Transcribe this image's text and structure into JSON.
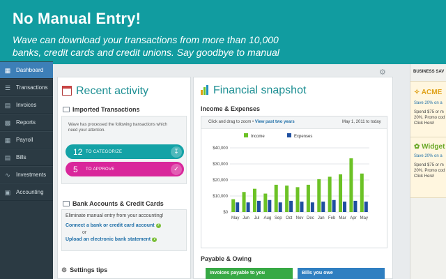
{
  "banner": {
    "title": "No Manual Entry!",
    "subtitle": "Wave can download your transactions from more than 10,000 banks, credit cards and credit unions. Say goodbye to manual entry!"
  },
  "sidebar": {
    "items": [
      {
        "label": "Dashboard",
        "icon": "dashboard-icon"
      },
      {
        "label": "Transactions",
        "icon": "transactions-icon"
      },
      {
        "label": "Invoices",
        "icon": "invoices-icon"
      },
      {
        "label": "Reports",
        "icon": "reports-icon"
      },
      {
        "label": "Payroll",
        "icon": "payroll-icon"
      },
      {
        "label": "Bills",
        "icon": "bills-icon"
      },
      {
        "label": "Investments",
        "icon": "investments-icon"
      },
      {
        "label": "Accounting",
        "icon": "accounting-icon"
      }
    ]
  },
  "recent": {
    "title": "Recent activity",
    "imported_head": "Imported Transactions",
    "imported_desc": "Wave has processed the following transactions which need your attention.",
    "categorize": {
      "count": "12",
      "label": "TO CATEGORIZE",
      "color": "#14a2a6"
    },
    "approve": {
      "count": "5",
      "label": "TO APPROVE",
      "color": "#d9279b"
    },
    "bank_head": "Bank Accounts & Credit Cards",
    "bank_desc": "Eliminate manual entry from your accounting!",
    "link_connect": "Connect a bank or credit card account",
    "or": "or",
    "link_upload": "Upload an electronic bank statement",
    "settings_head": "Settings tips"
  },
  "snapshot": {
    "title": "Financial snapshot",
    "income_head": "Income & Expenses",
    "zoom_hint": "Click and drag to zoom •",
    "view_link": "View past two years",
    "date_range": "May 1, 2011 to today",
    "payable_head": "Payable & Owing",
    "tab_invoices": "Invoices payable to you",
    "tab_bills": "Bills you owe"
  },
  "chart_data": {
    "type": "bar",
    "categories": [
      "May",
      "Jun",
      "Jul",
      "Aug",
      "Sep",
      "Oct",
      "Nov",
      "Dec",
      "Jan",
      "Feb",
      "Mar",
      "Apr",
      "May"
    ],
    "series": [
      {
        "name": "Income",
        "values": [
          8000,
          12500,
          14500,
          11500,
          17000,
          16500,
          15500,
          17000,
          20500,
          22000,
          23500,
          33500,
          24000
        ],
        "color": "#6cc226"
      },
      {
        "name": "Expenses",
        "values": [
          6000,
          6000,
          7000,
          7500,
          6000,
          7000,
          6500,
          6000,
          6500,
          7500,
          6500,
          7000,
          6500
        ],
        "color": "#1f4fa0"
      }
    ],
    "yticks": [
      "$40,000",
      "$30,000",
      "$20,000",
      "$10,000",
      "$0"
    ],
    "ylim": [
      0,
      40000
    ]
  },
  "ads": {
    "header": "BUSINESS SAV",
    "cards": [
      {
        "name": "ACME",
        "save": "Save 20% on a",
        "text": [
          "Spend $75 or m",
          "20%. Promo cod",
          "Click Here!"
        ],
        "color": "#e0a21a"
      },
      {
        "name": "Widget",
        "save": "Save 20% on a",
        "text": [
          "Spend $75 or m",
          "20%. Promo cod",
          "Click Here!"
        ],
        "color": "#6aa827"
      }
    ]
  }
}
